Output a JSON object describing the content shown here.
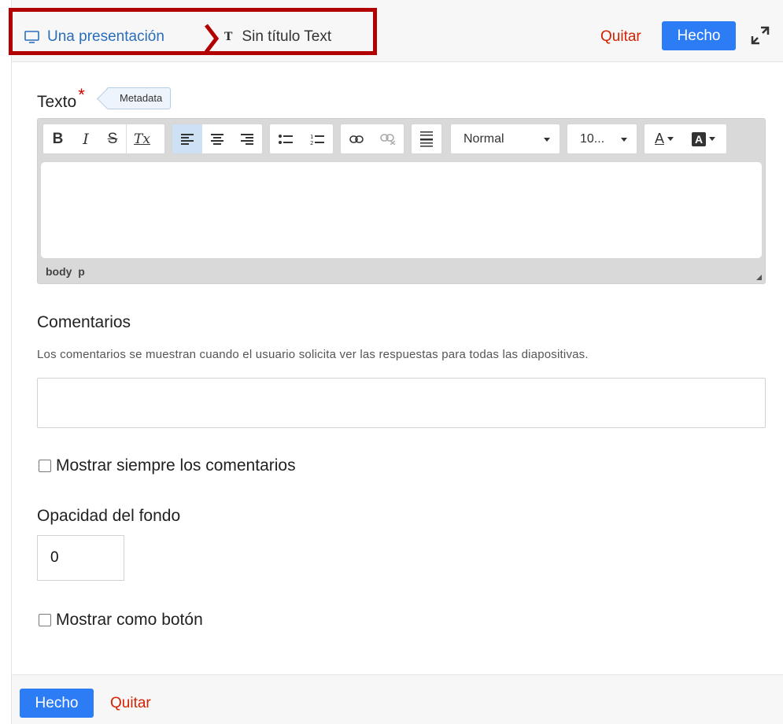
{
  "header": {
    "breadcrumb_parent": "Una presentación",
    "breadcrumb_current": "Sin título Text",
    "quitar_label": "Quitar",
    "hecho_label": "Hecho",
    "accent_color": "#2c7cf6",
    "danger_color": "#d32200",
    "highlight_border_color": "#b30000"
  },
  "texto": {
    "label": "Texto",
    "required_mark": "*",
    "metadata_label": "Metadata"
  },
  "editor": {
    "toolbar": {
      "bold": "B",
      "italic": "I",
      "strike": "S",
      "clear_format": "Tx",
      "format_select": "Normal",
      "size_select": "10...",
      "text_color": "A",
      "bg_color": "A"
    },
    "path": [
      "body",
      "p"
    ],
    "icons": [
      "bold-icon",
      "italic-icon",
      "strikethrough-icon",
      "clear-format-icon",
      "align-left-icon",
      "align-center-icon",
      "align-right-icon",
      "bulleted-list-icon",
      "numbered-list-icon",
      "link-icon",
      "unlink-icon",
      "horizontal-line-icon",
      "text-color-icon",
      "background-color-icon"
    ]
  },
  "comentarios": {
    "title": "Comentarios",
    "description": "Los comentarios se muestran cuando el usuario solicita ver las respuestas para todas las diapositivas.",
    "value": ""
  },
  "mostrar_siempre": {
    "label": "Mostrar siempre los comentarios",
    "checked": false
  },
  "opacidad": {
    "title": "Opacidad del fondo",
    "value": "0"
  },
  "mostrar_boton": {
    "label": "Mostrar como botón",
    "checked": false
  },
  "footer": {
    "hecho_label": "Hecho",
    "quitar_label": "Quitar"
  }
}
